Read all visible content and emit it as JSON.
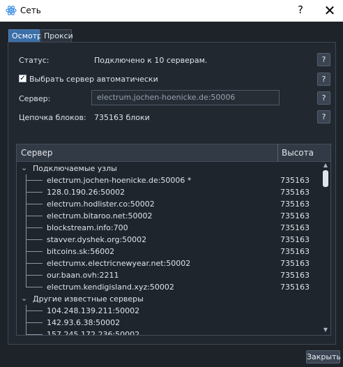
{
  "window": {
    "title": "Сеть",
    "help_label": "?",
    "close_label": "✕"
  },
  "tabs": [
    {
      "label": "Осмотр",
      "active": true
    },
    {
      "label": "Прокси",
      "active": false
    }
  ],
  "overview": {
    "status_label": "Статус:",
    "status_value": "Подключено к 10 серверам.",
    "auto_select_label": "Выбрать сервер автоматически",
    "auto_select_checked": true,
    "server_label": "Сервер:",
    "server_value": "electrum.jochen-hoenicke.de:50006",
    "blockchain_label": "Цепочка блоков:",
    "blockchain_value": "735163 блоки",
    "help_label": "?"
  },
  "tree": {
    "columns": [
      "Сервер",
      "Высота"
    ],
    "groups": [
      {
        "label": "Подключаемые узлы",
        "items": [
          {
            "name": "electrum.jochen-hoenicke.de:50006 *",
            "height": "735163"
          },
          {
            "name": "128.0.190.26:50002",
            "height": "735163"
          },
          {
            "name": "electrum.hodlister.co:50002",
            "height": "735163"
          },
          {
            "name": "electrum.bitaroo.net:50002",
            "height": "735163"
          },
          {
            "name": "blockstream.info:700",
            "height": "735163"
          },
          {
            "name": "stavver.dyshek.org:50002",
            "height": "735163"
          },
          {
            "name": "bitcoins.sk:56002",
            "height": "735163"
          },
          {
            "name": "electrumx.electricnewyear.net:50002",
            "height": "735163"
          },
          {
            "name": "our.baan.ovh:2211",
            "height": "735163"
          },
          {
            "name": "electrum.kendigisland.xyz:50002",
            "height": "735163"
          }
        ]
      },
      {
        "label": "Другие известные серверы",
        "items": [
          {
            "name": "104.248.139.211:50002",
            "height": ""
          },
          {
            "name": "142.93.6.38:50002",
            "height": ""
          },
          {
            "name": "157.245.172.236:50002",
            "height": ""
          }
        ]
      }
    ]
  },
  "footer": {
    "close_label": "Закрыть"
  },
  "icons": {
    "app": "electrum-atom-icon",
    "expand": "chevron-down-icon"
  },
  "colors": {
    "accent": "#3b6fa8",
    "background": "#1e2329"
  }
}
